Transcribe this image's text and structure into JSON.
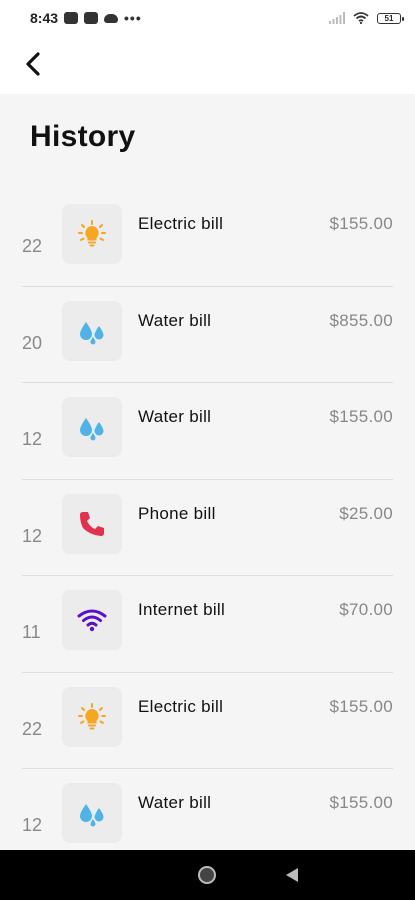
{
  "status_bar": {
    "time": "8:43",
    "dots": "•••",
    "battery": "51"
  },
  "header": {
    "back_icon": "chevron-left-icon"
  },
  "page": {
    "title": "History"
  },
  "colors": {
    "electric": "#f5a623",
    "water": "#4fb3e6",
    "phone": "#e0314f",
    "internet": "#5a0fc8",
    "amount": "#888888",
    "day": "#888888"
  },
  "history": [
    {
      "day": "22",
      "icon": "lightbulb-icon",
      "name": "Electric bill",
      "amount": "$155.00"
    },
    {
      "day": "20",
      "icon": "water-drops-icon",
      "name": "Water bill",
      "amount": "$855.00"
    },
    {
      "day": "12",
      "icon": "water-drops-icon",
      "name": "Water bill",
      "amount": "$155.00"
    },
    {
      "day": "12",
      "icon": "phone-icon",
      "name": "Phone bill",
      "amount": "$25.00"
    },
    {
      "day": "11",
      "icon": "wifi-icon",
      "name": "Internet bill",
      "amount": "$70.00"
    },
    {
      "day": "22",
      "icon": "lightbulb-icon",
      "name": "Electric bill",
      "amount": "$155.00"
    },
    {
      "day": "12",
      "icon": "water-drops-icon",
      "name": "Water bill",
      "amount": "$155.00"
    }
  ]
}
